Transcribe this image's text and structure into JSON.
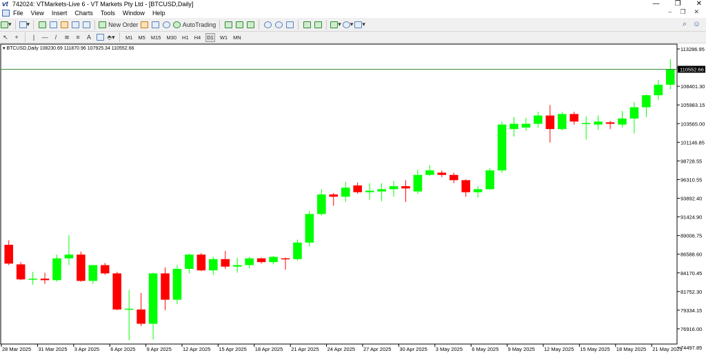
{
  "window": {
    "logo": "vt",
    "title": "742024: VTMarkets-Live 6 - VT Markets Pty Ltd - [BTCUSD,Daily]",
    "minimize": "—",
    "restore": "❐",
    "close": "✕"
  },
  "menu": {
    "items": [
      "File",
      "View",
      "Insert",
      "Charts",
      "Tools",
      "Window",
      "Help"
    ],
    "mdi_minimize": "–",
    "mdi_restore": "❐",
    "mdi_close": "✕"
  },
  "toolbar": {
    "new_order": "New Order",
    "autotrading": "AutoTrading"
  },
  "timeframes": {
    "items": [
      "M1",
      "M5",
      "M15",
      "M30",
      "H1",
      "H4",
      "D1",
      "W1",
      "MN"
    ],
    "active": "D1"
  },
  "chart_header": {
    "symbol": "BTCUSD,Daily",
    "ohlc": "108230.69 111870.96 107925.34 110552.66"
  },
  "chart_data": {
    "type": "candlestick",
    "symbol": "BTCUSD",
    "timeframe": "Daily",
    "current_price": 110552.66,
    "price_axis_labels": [
      "113286.95",
      "110869.10",
      "108401.30",
      "105983.15",
      "103565.00",
      "101146.85",
      "98728.55",
      "96310.55",
      "93892.40",
      "91424.90",
      "89006.75",
      "86588.60",
      "84170.45",
      "81752.30",
      "79334.15",
      "76916.00",
      "74497.85"
    ],
    "date_axis_labels": [
      "28 Mar 2025",
      "31 Mar 2025",
      "3 Apr 2025",
      "6 Apr 2025",
      "9 Apr 2025",
      "12 Apr 2025",
      "15 Apr 2025",
      "18 Apr 2025",
      "21 Apr 2025",
      "24 Apr 2025",
      "27 Apr 2025",
      "30 Apr 2025",
      "3 May 2025",
      "6 May 2025",
      "9 May 2025",
      "12 May 2025",
      "15 May 2025",
      "18 May 2025",
      "21 May 2025"
    ],
    "ylim": [
      74000,
      113900
    ],
    "bull_color": "#00ff00",
    "bear_color": "#ff0000",
    "price_line_color": "#3a8a3a",
    "candles": [
      {
        "o": 87200,
        "h": 87800,
        "l": 84500,
        "c": 84700
      },
      {
        "o": 84600,
        "h": 84900,
        "l": 82500,
        "c": 82600
      },
      {
        "o": 82600,
        "h": 83600,
        "l": 81900,
        "c": 82700
      },
      {
        "o": 82700,
        "h": 83500,
        "l": 82000,
        "c": 82500
      },
      {
        "o": 82500,
        "h": 85900,
        "l": 82300,
        "c": 85400
      },
      {
        "o": 85400,
        "h": 88500,
        "l": 84500,
        "c": 85900
      },
      {
        "o": 85900,
        "h": 86300,
        "l": 82300,
        "c": 82400
      },
      {
        "o": 82400,
        "h": 84500,
        "l": 82000,
        "c": 84500
      },
      {
        "o": 84500,
        "h": 84800,
        "l": 83200,
        "c": 83400
      },
      {
        "o": 83400,
        "h": 83600,
        "l": 78500,
        "c": 78600
      },
      {
        "o": 78600,
        "h": 81200,
        "l": 74500,
        "c": 78700
      },
      {
        "o": 78600,
        "h": 80800,
        "l": 76400,
        "c": 76700
      },
      {
        "o": 76700,
        "h": 83500,
        "l": 74600,
        "c": 83400
      },
      {
        "o": 83400,
        "h": 84200,
        "l": 78500,
        "c": 79900
      },
      {
        "o": 79900,
        "h": 84500,
        "l": 79300,
        "c": 84000
      },
      {
        "o": 84000,
        "h": 86000,
        "l": 83400,
        "c": 85900
      },
      {
        "o": 85900,
        "h": 86100,
        "l": 83700,
        "c": 83800
      },
      {
        "o": 83800,
        "h": 85600,
        "l": 83200,
        "c": 85300
      },
      {
        "o": 85300,
        "h": 86400,
        "l": 84000,
        "c": 84300
      },
      {
        "o": 84300,
        "h": 85500,
        "l": 83500,
        "c": 84500
      },
      {
        "o": 84500,
        "h": 85600,
        "l": 84100,
        "c": 85400
      },
      {
        "o": 85400,
        "h": 85500,
        "l": 84700,
        "c": 84900
      },
      {
        "o": 84900,
        "h": 85700,
        "l": 84600,
        "c": 85600
      },
      {
        "o": 85400,
        "h": 85500,
        "l": 83900,
        "c": 85300
      },
      {
        "o": 85300,
        "h": 87900,
        "l": 85100,
        "c": 87500
      },
      {
        "o": 87500,
        "h": 91700,
        "l": 87000,
        "c": 91300
      },
      {
        "o": 91300,
        "h": 94600,
        "l": 91100,
        "c": 93900
      },
      {
        "o": 93900,
        "h": 94100,
        "l": 92400,
        "c": 93600
      },
      {
        "o": 93600,
        "h": 95600,
        "l": 92900,
        "c": 94800
      },
      {
        "o": 95100,
        "h": 95500,
        "l": 94000,
        "c": 94200
      },
      {
        "o": 94200,
        "h": 95400,
        "l": 93200,
        "c": 94400
      },
      {
        "o": 94300,
        "h": 95400,
        "l": 93000,
        "c": 94600
      },
      {
        "o": 94600,
        "h": 95700,
        "l": 93600,
        "c": 95000
      },
      {
        "o": 95000,
        "h": 95800,
        "l": 92900,
        "c": 94700
      },
      {
        "o": 94300,
        "h": 97200,
        "l": 94000,
        "c": 96500
      },
      {
        "o": 96500,
        "h": 97800,
        "l": 96400,
        "c": 97100
      },
      {
        "o": 96800,
        "h": 97100,
        "l": 96200,
        "c": 96500
      },
      {
        "o": 96500,
        "h": 96800,
        "l": 95400,
        "c": 95800
      },
      {
        "o": 95800,
        "h": 95900,
        "l": 93600,
        "c": 94200
      },
      {
        "o": 94200,
        "h": 95000,
        "l": 93500,
        "c": 94600
      },
      {
        "o": 94600,
        "h": 97400,
        "l": 94500,
        "c": 97100
      },
      {
        "o": 97100,
        "h": 103600,
        "l": 96800,
        "c": 103200
      },
      {
        "o": 102600,
        "h": 104200,
        "l": 101600,
        "c": 103300
      },
      {
        "o": 102800,
        "h": 104100,
        "l": 102400,
        "c": 103300
      },
      {
        "o": 103300,
        "h": 104900,
        "l": 102800,
        "c": 104400
      },
      {
        "o": 104400,
        "h": 105800,
        "l": 100800,
        "c": 102600
      },
      {
        "o": 102600,
        "h": 104900,
        "l": 102400,
        "c": 104600
      },
      {
        "o": 104600,
        "h": 104900,
        "l": 103200,
        "c": 103600
      },
      {
        "o": 103400,
        "h": 104300,
        "l": 101200,
        "c": 103400
      },
      {
        "o": 103200,
        "h": 104400,
        "l": 102500,
        "c": 103600
      },
      {
        "o": 103500,
        "h": 103700,
        "l": 102600,
        "c": 103300
      },
      {
        "o": 103200,
        "h": 105000,
        "l": 102800,
        "c": 104000
      },
      {
        "o": 104000,
        "h": 106200,
        "l": 102000,
        "c": 105500
      },
      {
        "o": 105500,
        "h": 107200,
        "l": 104200,
        "c": 107100
      },
      {
        "o": 107100,
        "h": 109100,
        "l": 106500,
        "c": 108500
      },
      {
        "o": 108500,
        "h": 111900,
        "l": 107900,
        "c": 110600
      }
    ]
  }
}
